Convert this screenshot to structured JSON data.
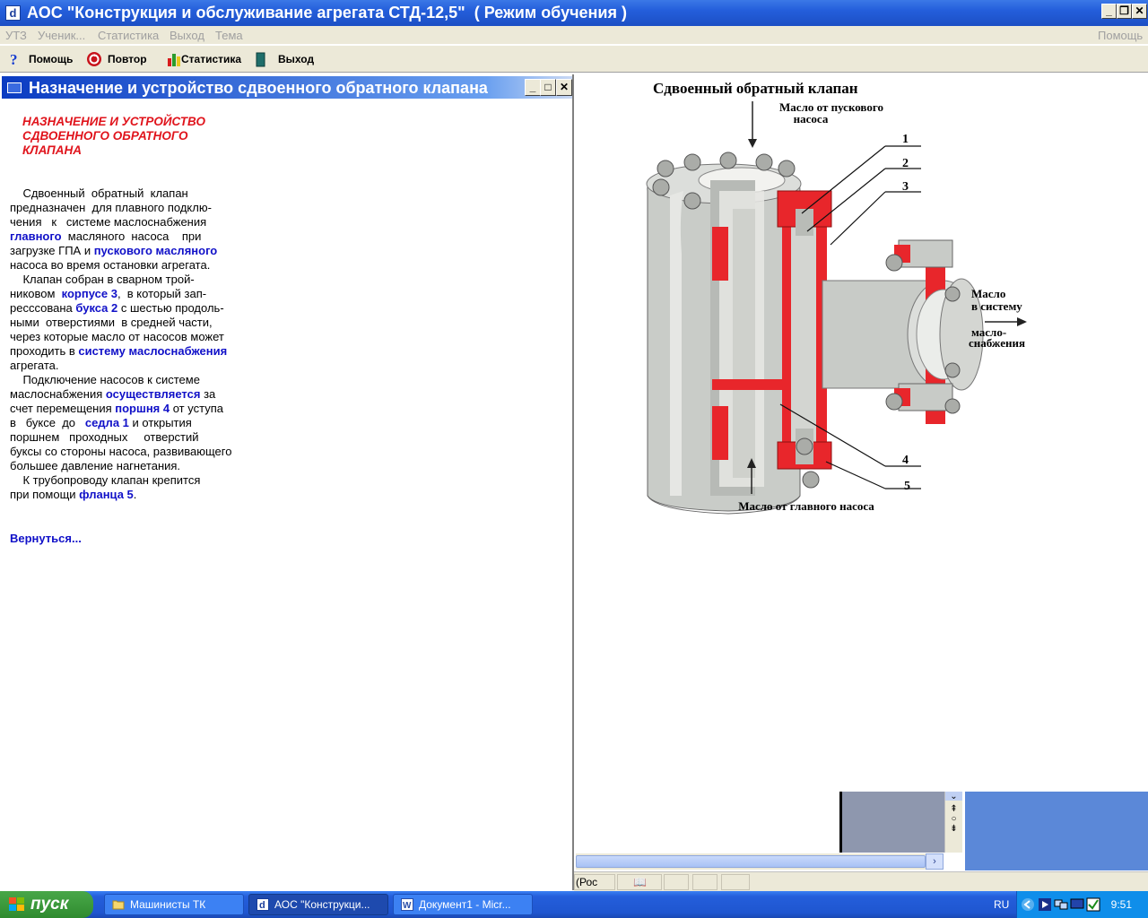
{
  "window": {
    "title": "АОС \"Конструкция и обслуживание агрегата СТД-12,5\"  ( Режим обучения )",
    "icon_letter": "d"
  },
  "menu": {
    "items": [
      "УТЗ",
      "Ученик...",
      "Статистика",
      "Выход",
      "Тема"
    ],
    "help": "Помощь"
  },
  "toolbar": {
    "help": "Помощь",
    "repeat": "Повтор",
    "stats": "Статистика",
    "exit": "Выход"
  },
  "left_panel": {
    "title": "Назначение и устройство сдвоенного обратного клапана",
    "heading_lines": [
      "НАЗНАЧЕНИЕ И УСТРОЙСТВО",
      "СДВОЕННОГО ОБРАТНОГО",
      "КЛАПАНА"
    ],
    "body": [
      [
        {
          "t": "    Сдвоенный  обратный  клапан"
        }
      ],
      [
        {
          "t": "предназначен  для плавного подклю-"
        }
      ],
      [
        {
          "t": "чения   к   системе маслоснабжения"
        }
      ],
      [
        {
          "t": "главного",
          "b": true
        },
        {
          "t": "  масляного  насоса    при"
        }
      ],
      [
        {
          "t": "загрузке ГПА и "
        },
        {
          "t": "пускового масляного",
          "b": true
        }
      ],
      [
        {
          "t": "насоса во время остановки агрегата."
        }
      ],
      [
        {
          "t": "    Клапан собран в сварном трой-"
        }
      ],
      [
        {
          "t": "никовом  "
        },
        {
          "t": "корпусе 3",
          "b": true
        },
        {
          "t": ",  в который зап-"
        }
      ],
      [
        {
          "t": "ресссована "
        },
        {
          "t": "букса 2",
          "b": true
        },
        {
          "t": " с шестью продоль-"
        }
      ],
      [
        {
          "t": "ными  отверстиями  в средней части,"
        }
      ],
      [
        {
          "t": "через которые масло от насосов может"
        }
      ],
      [
        {
          "t": "проходить в "
        },
        {
          "t": "систему маслоснабжения",
          "b": true
        }
      ],
      [
        {
          "t": "агрегата."
        }
      ],
      [
        {
          "t": "    Подключение насосов к системе"
        }
      ],
      [
        {
          "t": "маслоснабжения "
        },
        {
          "t": "осуществляется",
          "b": true
        },
        {
          "t": " за"
        }
      ],
      [
        {
          "t": "счет перемещения "
        },
        {
          "t": "поршня 4",
          "b": true
        },
        {
          "t": " от уступа"
        }
      ],
      [
        {
          "t": "в   буксе  до   "
        },
        {
          "t": "седла 1",
          "b": true
        },
        {
          "t": " и открытия"
        }
      ],
      [
        {
          "t": "поршнем   проходных     отверстий"
        }
      ],
      [
        {
          "t": "буксы со стороны насоса, развивающего"
        }
      ],
      [
        {
          "t": "большее давление нагнетания."
        }
      ],
      [
        {
          "t": "    К трубопроводу клапан крепится"
        }
      ],
      [
        {
          "t": "при помощи "
        },
        {
          "t": "фланца 5",
          "b": true
        },
        {
          "t": "."
        }
      ]
    ],
    "back_link": "Вернуться..."
  },
  "diagram": {
    "title": "Сдвоенный  обратный  клапан",
    "label_top_line1": "Масло от пускового",
    "label_top_line2": "насоса",
    "label_right_line1": "Масло",
    "label_right_line2": "в систему",
    "label_right_line3": "масло-",
    "label_right_line4": "снабжения",
    "label_bottom": "Масло от главного насоса",
    "callouts": [
      "1",
      "2",
      "3",
      "4",
      "5"
    ]
  },
  "status_bar": {
    "seg1": "(Рос"
  },
  "taskbar": {
    "start": "пуск",
    "tasks": [
      "Машинисты ТК",
      "АОС \"Конструкци...",
      "Документ1 - Micr..."
    ],
    "lang": "RU",
    "clock": "9:51"
  },
  "colors": {
    "section_red": "#e8262b",
    "link_blue": "#1010c8",
    "title_blue": "#245edb"
  }
}
